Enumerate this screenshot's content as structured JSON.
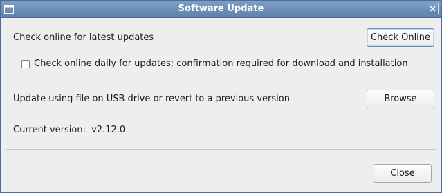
{
  "window": {
    "title": "Software Update",
    "icon": "window-icon",
    "close_icon": "close-icon"
  },
  "online": {
    "description": "Check online for latest updates",
    "button_label": "Check Online",
    "daily_check": {
      "label": "Check online daily for updates; confirmation required for download and installation",
      "checked": false
    }
  },
  "usb": {
    "description": "Update using file on USB drive or revert to a previous version",
    "button_label": "Browse"
  },
  "version": {
    "label": "Current version:",
    "value": "v2.12.0"
  },
  "footer": {
    "close_label": "Close"
  },
  "colors": {
    "titlebar": "#6b8db8",
    "background": "#eeeeee"
  }
}
